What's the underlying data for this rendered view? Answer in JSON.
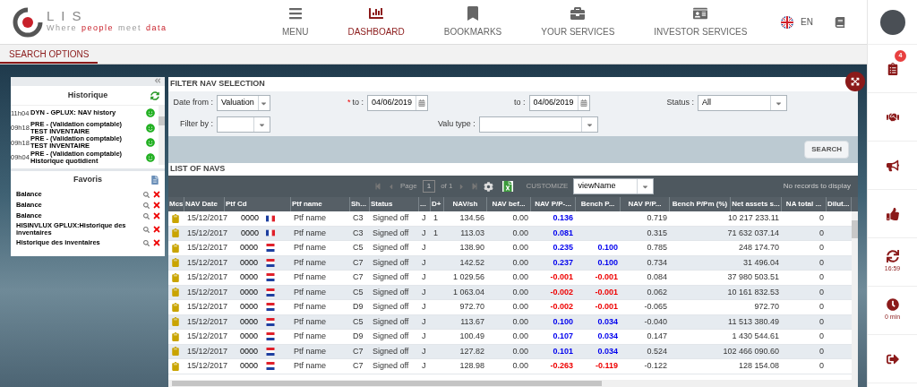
{
  "logo": {
    "name": "LIS",
    "tagline": [
      {
        "text": "Where",
        "accent": false
      },
      {
        "text": "people",
        "accent": true
      },
      {
        "text": "meet",
        "accent": false
      },
      {
        "text": "data",
        "accent": true
      }
    ]
  },
  "nav": [
    {
      "kind": "menu",
      "label": "MENU",
      "selected": false
    },
    {
      "kind": "dashboard",
      "label": "DASHBOARD",
      "selected": true
    },
    {
      "kind": "bookmarks",
      "label": "BOOKMARKS",
      "selected": false
    },
    {
      "kind": "services",
      "label": "YOUR SERVICES",
      "selected": false
    },
    {
      "kind": "investor",
      "label": "INVESTOR SERVICES",
      "selected": false
    }
  ],
  "language": "EN",
  "search_tab": {
    "label": "SEARCH OPTIONS",
    "selected": true
  },
  "historique": {
    "title": "Historique",
    "items": [
      {
        "time": "11h04",
        "lines": [
          "DYN - GPLUX: NAV history"
        ]
      },
      {
        "time": "09h18",
        "lines": [
          "PRE - (Validation comptable)",
          "TEST INVENTAIRE"
        ]
      },
      {
        "time": "09h18",
        "lines": [
          "PRE - (Validation comptable)",
          "TEST INVENTAIRE"
        ]
      },
      {
        "time": "09h04",
        "lines": [
          "PRE - (Validation comptable)",
          "Historique quotidient"
        ]
      }
    ]
  },
  "favoris": {
    "title": "Favoris",
    "items": [
      "Balance",
      "Balance",
      "Balance",
      "HISINVLUX GPLUX:Historique des inventaires",
      "Historique des inventaires"
    ]
  },
  "filter": {
    "title": "FILTER NAV SELECTION",
    "date_from": {
      "label": "Date from :",
      "value": "Valuation"
    },
    "to_1": {
      "required_mark": "*",
      "label": "to :",
      "value": "04/06/2019"
    },
    "to_2": {
      "label": "to :",
      "value": "04/06/2019"
    },
    "status": {
      "label": "Status :",
      "value": "All"
    },
    "filter_by": {
      "label": "Filter by :"
    },
    "valu_type": {
      "label": "Valu type :"
    },
    "search_button": "SEARCH"
  },
  "navs": {
    "title": "LIST OF NAVS",
    "pager": {
      "page_label": "Page",
      "page": "1",
      "of": "of 1"
    },
    "customize": {
      "label": "CUSTOMIZE",
      "value": "viewName"
    },
    "no_records": "No records to display",
    "columns": [
      "Mcs",
      "NAV Date",
      "Ptf Cd",
      "Ptf name",
      "Sh...",
      "Status",
      "...",
      "D+",
      "NAV/sh",
      "NAV bef...",
      "NAV P/P-...",
      "Bench P...",
      "NAV P/P...",
      "Bench P/Pm (%)",
      "Net assets s...",
      "NA total ...",
      "Dilut..."
    ],
    "rows": [
      {
        "date": "15/12/2017",
        "ptf_cd": "0000",
        "kind": "fr",
        "ptf_name": "Ptf name",
        "share": "C3",
        "status": "Signed off",
        "col_7": "J",
        "d_plus": "1",
        "nav_sh": "134.56",
        "nav_bef": "0.00",
        "nav_pp": "0.136",
        "nav_pp2": "0.719",
        "net_assets": "10 217 233.11",
        "na_total": "0",
        "color": "#0000ee"
      },
      {
        "date": "15/12/2017",
        "ptf_cd": "0000",
        "kind": "fr",
        "ptf_name": "Ptf name",
        "share": "C3",
        "status": "Signed off",
        "col_7": "J",
        "d_plus": "1",
        "nav_sh": "113.03",
        "nav_bef": "0.00",
        "nav_pp": "0.081",
        "nav_pp2": "0.315",
        "net_assets": "71 632 037.14",
        "na_total": "0",
        "color": "#0000ee"
      },
      {
        "date": "15/12/2017",
        "ptf_cd": "0000",
        "kind": "nl",
        "ptf_name": "Ptf name",
        "share": "C5",
        "status": "Signed off",
        "col_7": "J",
        "nav_sh": "138.90",
        "nav_bef": "0.00",
        "nav_pp": "0.235",
        "bench_p": "0.100",
        "nav_pp2": "0.785",
        "net_assets": "248 174.70",
        "na_total": "0",
        "color": "#0000ee"
      },
      {
        "date": "15/12/2017",
        "ptf_cd": "0000",
        "kind": "nl",
        "ptf_name": "Ptf name",
        "share": "C7",
        "status": "Signed off",
        "col_7": "J",
        "nav_sh": "142.52",
        "nav_bef": "0.00",
        "nav_pp": "0.237",
        "bench_p": "0.100",
        "nav_pp2": "0.734",
        "net_assets": "31 496.04",
        "na_total": "0",
        "color": "#0000ee"
      },
      {
        "date": "15/12/2017",
        "ptf_cd": "0000",
        "kind": "nl",
        "ptf_name": "Ptf name",
        "share": "C7",
        "status": "Signed off",
        "col_7": "J",
        "nav_sh": "1 029.56",
        "nav_bef": "0.00",
        "nav_pp": "-0.001",
        "bench_p": "-0.001",
        "nav_pp2": "0.084",
        "net_assets": "37 980 503.51",
        "na_total": "0",
        "color": "#ee0000"
      },
      {
        "date": "15/12/2017",
        "ptf_cd": "0000",
        "kind": "nl",
        "ptf_name": "Ptf name",
        "share": "C5",
        "status": "Signed off",
        "col_7": "J",
        "nav_sh": "1 063.04",
        "nav_bef": "0.00",
        "nav_pp": "-0.002",
        "bench_p": "-0.001",
        "nav_pp2": "0.062",
        "net_assets": "10 161 832.53",
        "na_total": "0",
        "color": "#ee0000"
      },
      {
        "date": "15/12/2017",
        "ptf_cd": "0000",
        "kind": "nl",
        "ptf_name": "Ptf name",
        "share": "D9",
        "status": "Signed off",
        "col_7": "J",
        "nav_sh": "972.70",
        "nav_bef": "0.00",
        "nav_pp": "-0.002",
        "bench_p": "-0.001",
        "nav_pp2": "-0.065",
        "net_assets": "972.70",
        "na_total": "0",
        "color": "#ee0000"
      },
      {
        "date": "15/12/2017",
        "ptf_cd": "0000",
        "kind": "nl",
        "ptf_name": "Ptf name",
        "share": "C5",
        "status": "Signed off",
        "col_7": "J",
        "nav_sh": "113.67",
        "nav_bef": "0.00",
        "nav_pp": "0.100",
        "bench_p": "0.034",
        "nav_pp2": "-0.040",
        "net_assets": "11 513 380.49",
        "na_total": "0",
        "color": "#0000ee"
      },
      {
        "date": "15/12/2017",
        "ptf_cd": "0000",
        "kind": "nl",
        "ptf_name": "Ptf name",
        "share": "D9",
        "status": "Signed off",
        "col_7": "J",
        "nav_sh": "100.49",
        "nav_bef": "0.00",
        "nav_pp": "0.107",
        "bench_p": "0.034",
        "nav_pp2": "0.147",
        "net_assets": "1 430 544.61",
        "na_total": "0",
        "color": "#0000ee"
      },
      {
        "date": "15/12/2017",
        "ptf_cd": "0000",
        "kind": "nl",
        "ptf_name": "Ptf name",
        "share": "C7",
        "status": "Signed off",
        "col_7": "J",
        "nav_sh": "127.82",
        "nav_bef": "0.00",
        "nav_pp": "0.101",
        "bench_p": "0.034",
        "nav_pp2": "0.524",
        "net_assets": "102 466 090.60",
        "na_total": "0",
        "color": "#0000ee"
      },
      {
        "date": "15/12/2017",
        "ptf_cd": "0000",
        "kind": "nl",
        "ptf_name": "Ptf name",
        "share": "C7",
        "status": "Signed off",
        "col_7": "J",
        "nav_sh": "128.98",
        "nav_bef": "0.00",
        "nav_pp": "-0.263",
        "bench_p": "-0.119",
        "nav_pp2": "-0.122",
        "net_assets": "128 154.08",
        "na_total": "0",
        "color": "#ee0000"
      }
    ]
  },
  "sidebar": [
    {
      "kind": "list",
      "badge": "4"
    },
    {
      "kind": "handshake"
    },
    {
      "kind": "bullhorn"
    },
    {
      "kind": "thumbs"
    },
    {
      "kind": "refresh",
      "caption": "16:59"
    },
    {
      "kind": "clock",
      "caption": "0 min"
    },
    {
      "kind": "signout"
    }
  ]
}
